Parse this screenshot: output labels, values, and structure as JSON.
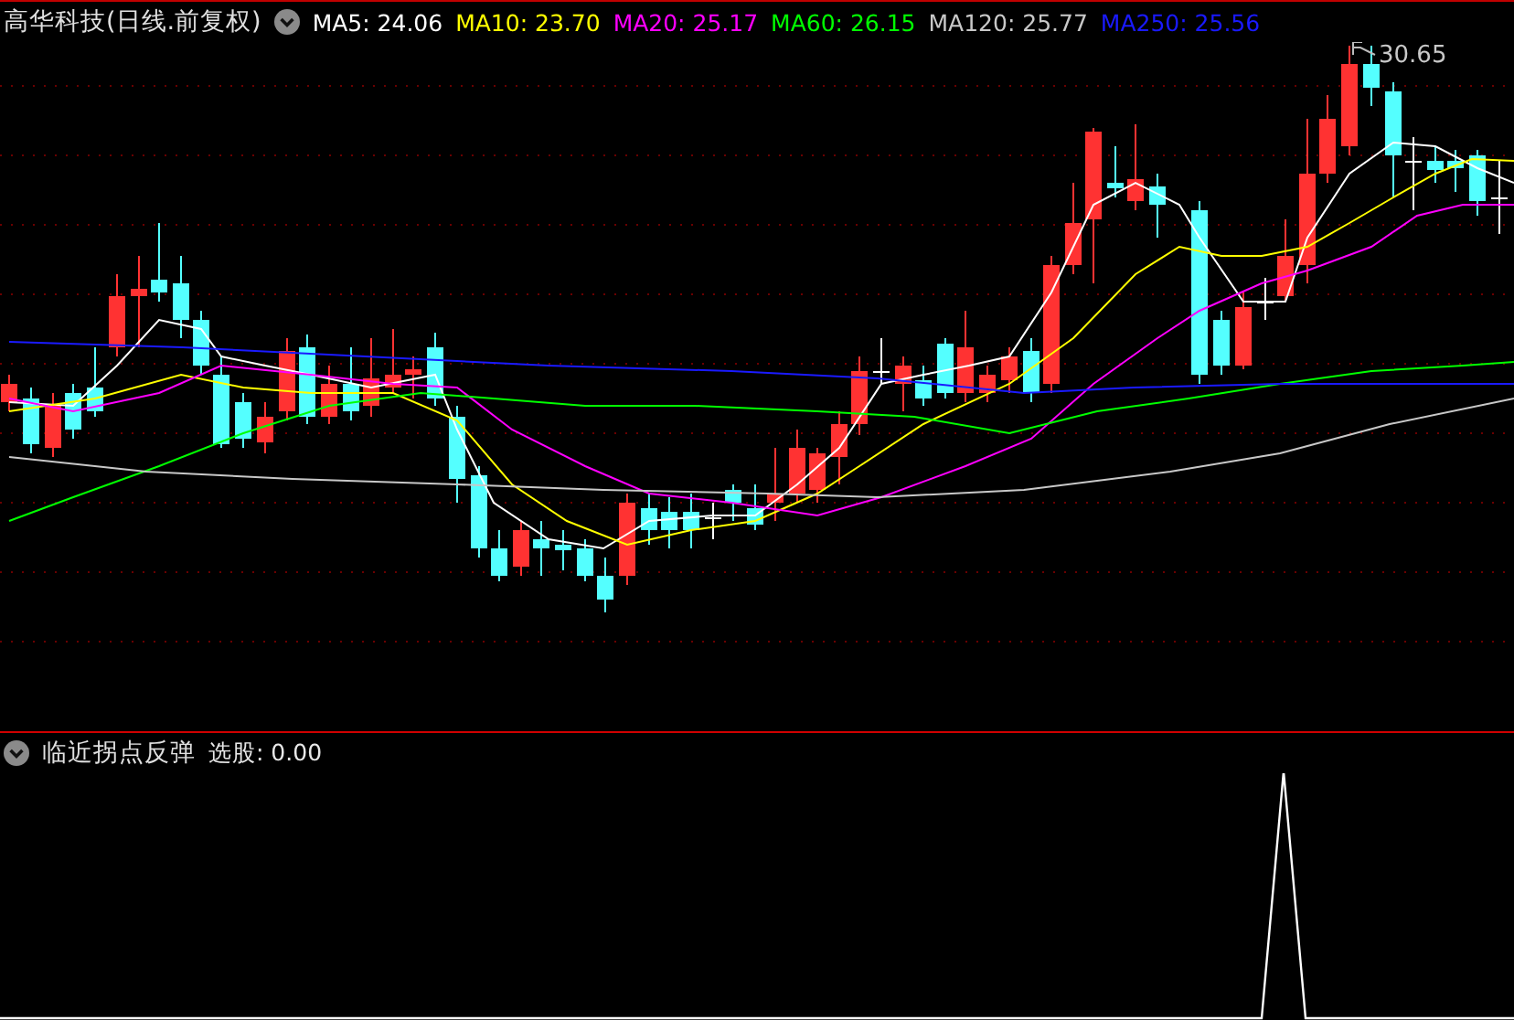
{
  "main_panel": {
    "title": "高华科技(日线.前复权)",
    "indicators": [
      {
        "label": "MA5: 24.06",
        "color": "#ffffff"
      },
      {
        "label": "MA10: 23.70",
        "color": "#ffff00"
      },
      {
        "label": "MA20: 25.17",
        "color": "#ff00ff"
      },
      {
        "label": "MA60: 26.15",
        "color": "#00ff00"
      },
      {
        "label": "MA120: 25.77",
        "color": "#c8c8c8"
      },
      {
        "label": "MA250: 25.56",
        "color": "#1a1aff"
      }
    ],
    "high_label": "30.65"
  },
  "sub_panel": {
    "title": "临近拐点反弹",
    "reading": "选股: 0.00"
  }
}
